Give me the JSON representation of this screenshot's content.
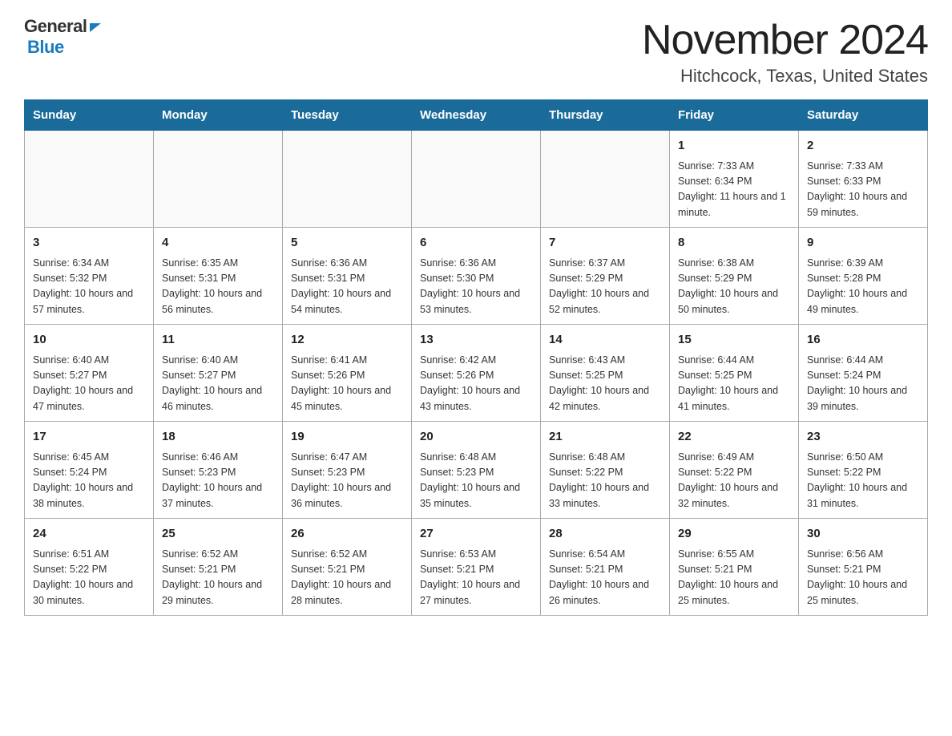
{
  "header": {
    "logo_general": "General",
    "logo_blue": "Blue",
    "month_title": "November 2024",
    "location": "Hitchcock, Texas, United States"
  },
  "days_of_week": [
    "Sunday",
    "Monday",
    "Tuesday",
    "Wednesday",
    "Thursday",
    "Friday",
    "Saturday"
  ],
  "weeks": [
    {
      "days": [
        {
          "number": "",
          "info": ""
        },
        {
          "number": "",
          "info": ""
        },
        {
          "number": "",
          "info": ""
        },
        {
          "number": "",
          "info": ""
        },
        {
          "number": "",
          "info": ""
        },
        {
          "number": "1",
          "info": "Sunrise: 7:33 AM\nSunset: 6:34 PM\nDaylight: 11 hours and 1 minute."
        },
        {
          "number": "2",
          "info": "Sunrise: 7:33 AM\nSunset: 6:33 PM\nDaylight: 10 hours and 59 minutes."
        }
      ]
    },
    {
      "days": [
        {
          "number": "3",
          "info": "Sunrise: 6:34 AM\nSunset: 5:32 PM\nDaylight: 10 hours and 57 minutes."
        },
        {
          "number": "4",
          "info": "Sunrise: 6:35 AM\nSunset: 5:31 PM\nDaylight: 10 hours and 56 minutes."
        },
        {
          "number": "5",
          "info": "Sunrise: 6:36 AM\nSunset: 5:31 PM\nDaylight: 10 hours and 54 minutes."
        },
        {
          "number": "6",
          "info": "Sunrise: 6:36 AM\nSunset: 5:30 PM\nDaylight: 10 hours and 53 minutes."
        },
        {
          "number": "7",
          "info": "Sunrise: 6:37 AM\nSunset: 5:29 PM\nDaylight: 10 hours and 52 minutes."
        },
        {
          "number": "8",
          "info": "Sunrise: 6:38 AM\nSunset: 5:29 PM\nDaylight: 10 hours and 50 minutes."
        },
        {
          "number": "9",
          "info": "Sunrise: 6:39 AM\nSunset: 5:28 PM\nDaylight: 10 hours and 49 minutes."
        }
      ]
    },
    {
      "days": [
        {
          "number": "10",
          "info": "Sunrise: 6:40 AM\nSunset: 5:27 PM\nDaylight: 10 hours and 47 minutes."
        },
        {
          "number": "11",
          "info": "Sunrise: 6:40 AM\nSunset: 5:27 PM\nDaylight: 10 hours and 46 minutes."
        },
        {
          "number": "12",
          "info": "Sunrise: 6:41 AM\nSunset: 5:26 PM\nDaylight: 10 hours and 45 minutes."
        },
        {
          "number": "13",
          "info": "Sunrise: 6:42 AM\nSunset: 5:26 PM\nDaylight: 10 hours and 43 minutes."
        },
        {
          "number": "14",
          "info": "Sunrise: 6:43 AM\nSunset: 5:25 PM\nDaylight: 10 hours and 42 minutes."
        },
        {
          "number": "15",
          "info": "Sunrise: 6:44 AM\nSunset: 5:25 PM\nDaylight: 10 hours and 41 minutes."
        },
        {
          "number": "16",
          "info": "Sunrise: 6:44 AM\nSunset: 5:24 PM\nDaylight: 10 hours and 39 minutes."
        }
      ]
    },
    {
      "days": [
        {
          "number": "17",
          "info": "Sunrise: 6:45 AM\nSunset: 5:24 PM\nDaylight: 10 hours and 38 minutes."
        },
        {
          "number": "18",
          "info": "Sunrise: 6:46 AM\nSunset: 5:23 PM\nDaylight: 10 hours and 37 minutes."
        },
        {
          "number": "19",
          "info": "Sunrise: 6:47 AM\nSunset: 5:23 PM\nDaylight: 10 hours and 36 minutes."
        },
        {
          "number": "20",
          "info": "Sunrise: 6:48 AM\nSunset: 5:23 PM\nDaylight: 10 hours and 35 minutes."
        },
        {
          "number": "21",
          "info": "Sunrise: 6:48 AM\nSunset: 5:22 PM\nDaylight: 10 hours and 33 minutes."
        },
        {
          "number": "22",
          "info": "Sunrise: 6:49 AM\nSunset: 5:22 PM\nDaylight: 10 hours and 32 minutes."
        },
        {
          "number": "23",
          "info": "Sunrise: 6:50 AM\nSunset: 5:22 PM\nDaylight: 10 hours and 31 minutes."
        }
      ]
    },
    {
      "days": [
        {
          "number": "24",
          "info": "Sunrise: 6:51 AM\nSunset: 5:22 PM\nDaylight: 10 hours and 30 minutes."
        },
        {
          "number": "25",
          "info": "Sunrise: 6:52 AM\nSunset: 5:21 PM\nDaylight: 10 hours and 29 minutes."
        },
        {
          "number": "26",
          "info": "Sunrise: 6:52 AM\nSunset: 5:21 PM\nDaylight: 10 hours and 28 minutes."
        },
        {
          "number": "27",
          "info": "Sunrise: 6:53 AM\nSunset: 5:21 PM\nDaylight: 10 hours and 27 minutes."
        },
        {
          "number": "28",
          "info": "Sunrise: 6:54 AM\nSunset: 5:21 PM\nDaylight: 10 hours and 26 minutes."
        },
        {
          "number": "29",
          "info": "Sunrise: 6:55 AM\nSunset: 5:21 PM\nDaylight: 10 hours and 25 minutes."
        },
        {
          "number": "30",
          "info": "Sunrise: 6:56 AM\nSunset: 5:21 PM\nDaylight: 10 hours and 25 minutes."
        }
      ]
    }
  ],
  "colors": {
    "header_bg": "#1a6b9a",
    "header_text": "#ffffff",
    "border": "#999999"
  }
}
